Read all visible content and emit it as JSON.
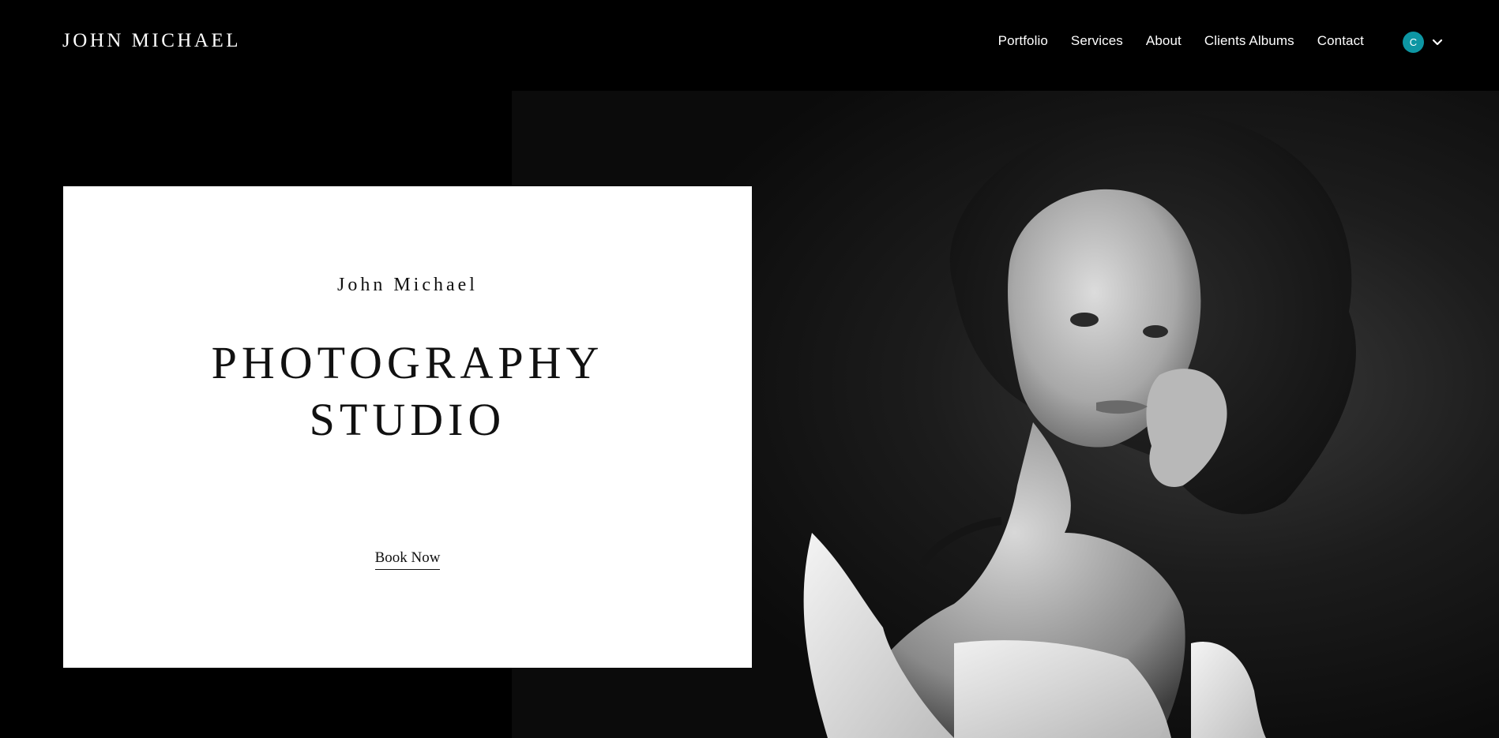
{
  "header": {
    "brand": "JOHN MICHAEL",
    "nav": [
      {
        "label": "Portfolio"
      },
      {
        "label": "Services"
      },
      {
        "label": "About"
      },
      {
        "label": "Clients Albums"
      },
      {
        "label": "Contact"
      }
    ],
    "account": {
      "avatar_letter": "C",
      "avatar_color": "#0d96a3",
      "menu_icon": "chevron-down-icon"
    }
  },
  "hero": {
    "subtitle": "John Michael",
    "title_line1": "PHOTOGRAPHY",
    "title_line2": "STUDIO",
    "cta_label": "Book Now"
  },
  "colors": {
    "background": "#000000",
    "card": "#ffffff",
    "text_dark": "#111111",
    "text_light": "#ffffff"
  }
}
